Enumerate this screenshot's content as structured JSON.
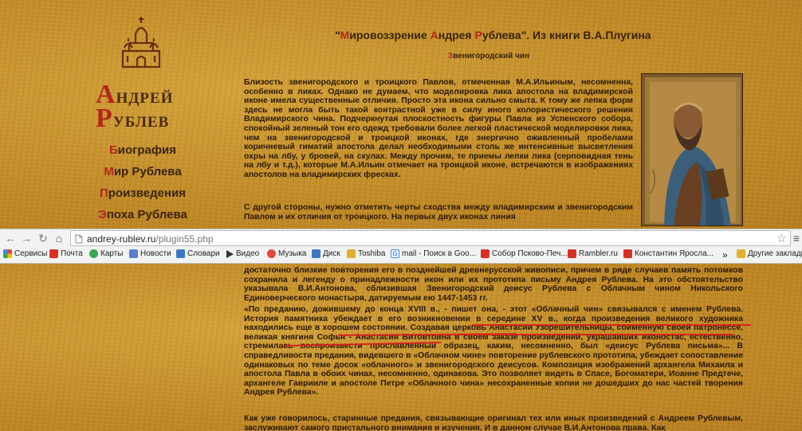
{
  "site": {
    "logo_line1_cap": "А",
    "logo_line1_rest": "ндрей",
    "logo_line2_cap": "Р",
    "logo_line2_rest": "ублев",
    "nav": [
      {
        "cap": "Б",
        "rest": "иография"
      },
      {
        "cap": "М",
        "rest": "ир Рублева"
      },
      {
        "cap": "П",
        "rest": "роизведения"
      },
      {
        "cap": "Э",
        "rest": "поха Рублева"
      }
    ]
  },
  "article": {
    "title_q1": "\"",
    "title_c1": "М",
    "title_t1": "ировоззрение ",
    "title_c2": "А",
    "title_t2": "ндрея ",
    "title_c3": "Р",
    "title_t3": "ублева\". Из книги В.А.Плугина",
    "subtitle_cap": "З",
    "subtitle_rest": "венигородский чин",
    "para_top": "Близость звенигородского и троицкого Павлов, отмеченная М.А.Ильиным, несомненна, особенно в ликах. Однако не думаем, что моделировка лика апостола на владимирской иконе имела существенные отличия. Просто эта икона сильно смыта. К тому же лепка форм здесь не могла быть такой контрастной уже в силу иного колористического решения Владимирского чина. Подчеркнутая плоскостность фигуры Павла из Успенского собора, спокойный зеленый тон его одежд требовали более легкой пластической моделировки лика, чем на звенигородской и троицкой иконах, где энергично оживленный пробелами коричневый гиматий апостола делал необходимыми столь же интенсивные высветления охры на лбу, у бровей, на скулах. Между прочим, те приемы лепки лика (серповидная тень на лбу и т.д.), которые М.А.Ильин отмечает на троицкой иконе, встречаются в изображениях апостолов на владимирских фресках.",
    "para_top2": "С другой стороны, нужно отметить черты сходства между владимирским и звенигородским Павлом и их отличия от троицкого. На первых двух иконах линия",
    "para_bottom_a": "достаточно близкие повторения его в позднейшей древнерусской живописи, причем в ряде случаев память потомков сохранила и легенду о принадлежности икон или их прототипа письму Андрея Рублева. На это обстоятельство указывала В.И.Антонова, сблизившая Звенигородский деисус Рублева с Облачным чином Никольского Единоверческого монастыря, датируемым ею 1447-1453 гг.",
    "para_bottom_b": "«По преданию, дожившему до конца XVIII в., - пишет она, - этот «Облачный чин» связывался с именем Рублева. История памятника убеждает в его возникновении в середине XV в., когда произведения великого художника находились еще в хорошем состоянии. Создавая церковь Анастасии Узорешительницы, соименную своей патронессе, великая княгиня Софья - Анастасия Витовтовна в своем заказе произведений, украшавших иконостас, естественно, стремилась воспроизвести прославленный образец, каким, несомненно, был «деисус Рублева письма»... В справедливости предания, видевшего в «Облачном чине» повторение рублевского прототипа, убеждает сопоставление одинаковых по теме досок «облачного» и звенигородского деисусов. Композиция изображений архангела Михаила и апостола Павла в обоих чинах, несомненно, одинакова. Это позволяет видеть в Спасе, Богоматери, Иоанне Предтече, архангеле Гаврииле и апостоле Петре «Облачного чина» несохраненные копии не дошедших до нас частей творения Андрея Рублева».",
    "para_bottom_c": "Как уже говорилось, старинные предания, связывающие оригинал тех или иных произведений с Андреем Рублевым, заслуживают самого пристального внимания и изучения. И в данном случае В.И.Антонова права. Как"
  },
  "browser": {
    "url_domain": "andrey-rublev.ru",
    "url_path": "/plugin55.php",
    "bookmarks": [
      {
        "label": "Сервисы",
        "color": "#e8453c",
        "icon": "apps-icon"
      },
      {
        "label": "Почта",
        "color": "#d93025",
        "icon": "yandex-icon"
      },
      {
        "label": "Карты",
        "color": "#34a853",
        "icon": "maps-icon"
      },
      {
        "label": "Новости",
        "color": "#5b7bd5",
        "icon": "news-icon"
      },
      {
        "label": "Словари",
        "color": "#3b78c2",
        "icon": "dict-icon"
      },
      {
        "label": "Видео",
        "color": "#333333",
        "icon": "video-icon"
      },
      {
        "label": "Музыка",
        "color": "#e8453c",
        "icon": "music-icon"
      },
      {
        "label": "Диск",
        "color": "#3b78c2",
        "icon": "disk-icon"
      },
      {
        "label": "Toshiba",
        "color": "#e0b030",
        "icon": "folder-icon"
      },
      {
        "label": "mail - Поиск в Goo...",
        "color": "#4285f4",
        "icon": "google-icon"
      },
      {
        "label": "Собор Псково-Печ...",
        "color": "#d93025",
        "icon": "yandex-icon"
      },
      {
        "label": "Rambler.ru",
        "color": "#d93025",
        "icon": "yandex-icon"
      },
      {
        "label": "Константин Яросла...",
        "color": "#d93025",
        "icon": "yandex-icon"
      },
      {
        "label": "»",
        "color": "#777777",
        "icon": "more-icon"
      },
      {
        "label": "Другие закладки",
        "color": "#e0b030",
        "icon": "folder-icon"
      }
    ]
  }
}
